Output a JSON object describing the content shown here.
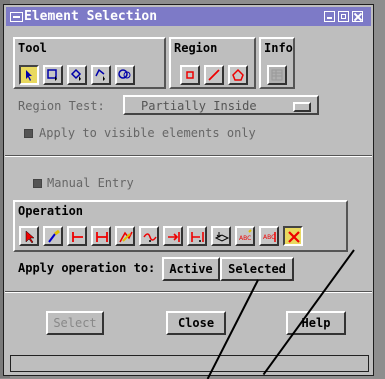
{
  "window": {
    "title": "Element Selection"
  },
  "tool": {
    "label": "Tool",
    "buttons": [
      "point-select-icon",
      "box-select-icon",
      "polygon-select-icon",
      "polyline-select-icon",
      "circle-select-icon"
    ]
  },
  "region": {
    "label": "Region",
    "buttons": [
      "box-region-icon",
      "line-region-icon",
      "polygon-region-icon"
    ]
  },
  "info": {
    "label": "Info"
  },
  "region_test": {
    "label": "Region Test:",
    "value": "Partially Inside"
  },
  "apply_visible": {
    "label": "Apply to visible elements only"
  },
  "manual_entry": {
    "label": "Manual Entry"
  },
  "operation": {
    "label": "Operation",
    "buttons": [
      "select-arrow-icon",
      "paint-brush-icon",
      "line-endpoints-icon",
      "segment-icon",
      "edit-curve-icon",
      "node-edit-icon",
      "extend-line-icon",
      "trim-icon",
      "layer-stack-icon",
      "text-label-icon",
      "text-edit-icon",
      "delete-x-icon"
    ]
  },
  "apply_operation": {
    "label": "Apply operation to:",
    "active": "Active",
    "selected": "Selected"
  },
  "buttons": {
    "select": "Select",
    "close": "Close",
    "help": "Help"
  },
  "colors": {
    "titlebar": "#7d7ac7",
    "highlight": "#e9d95f",
    "red": "#e00000"
  }
}
